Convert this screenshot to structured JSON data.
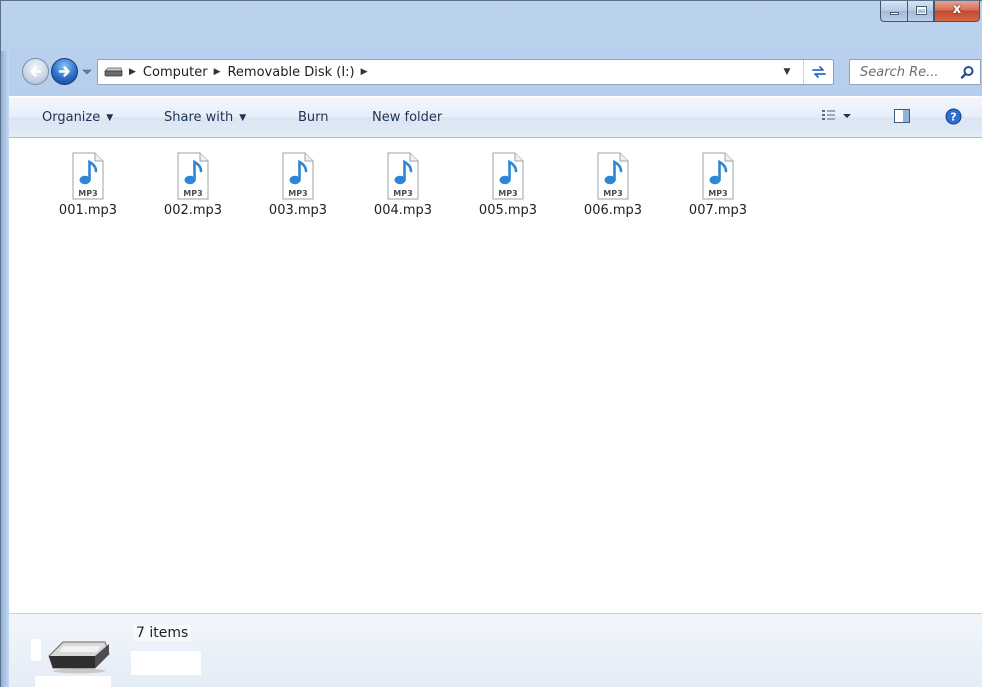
{
  "window": {
    "caption": {
      "minimize_icon": "minimize-icon",
      "maximize_icon": "maximize-icon",
      "close_label": "x"
    },
    "accent": "#2a6fc9"
  },
  "navigation": {
    "back_icon": "back-arrow-icon",
    "forward_icon": "forward-arrow-icon",
    "breadcrumbs": [
      "Computer",
      "Removable Disk (I:)"
    ],
    "search_placeholder": "Search Re..."
  },
  "toolbar": {
    "organize": "Organize",
    "share_with": "Share with",
    "burn": "Burn",
    "new_folder": "New folder",
    "views_icon": "view-options-icon",
    "preview_pane_icon": "preview-pane-icon",
    "help_icon": "help-icon"
  },
  "files": [
    {
      "name": "001.mp3",
      "badge": "MP3"
    },
    {
      "name": "002.mp3",
      "badge": "MP3"
    },
    {
      "name": "003.mp3",
      "badge": "MP3"
    },
    {
      "name": "004.mp3",
      "badge": "MP3"
    },
    {
      "name": "005.mp3",
      "badge": "MP3"
    },
    {
      "name": "006.mp3",
      "badge": "MP3"
    },
    {
      "name": "007.mp3",
      "badge": "MP3"
    }
  ],
  "details": {
    "item_count": "7 items",
    "icon": "removable-drive-icon"
  }
}
